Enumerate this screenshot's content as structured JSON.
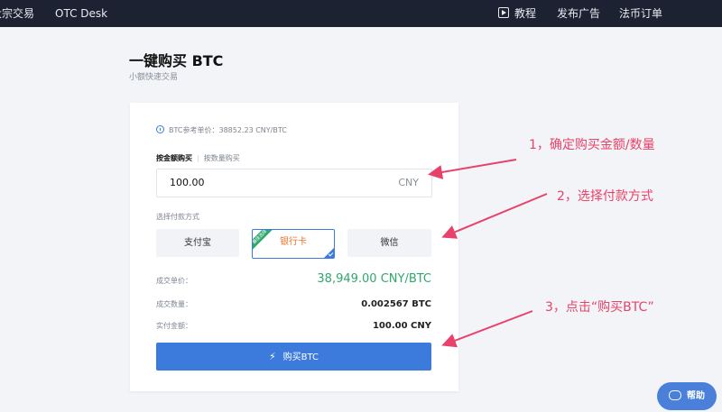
{
  "nav": {
    "left_items": [
      "大宗交易",
      "OTC Desk"
    ],
    "right_items": [
      "教程",
      "发布广告",
      "法币订单"
    ]
  },
  "header": {
    "title": "一键购买 BTC",
    "subtitle": "小额快速交易"
  },
  "form": {
    "reference_price": "BTC参考单价：38852.23 CNY/BTC",
    "mode_active": "按金额购买",
    "mode_other": "按数量购买",
    "amount_value": "100.00",
    "amount_unit": "CNY",
    "pay_method_label": "选择付款方式",
    "pay_methods": [
      "支付宝",
      "银行卡",
      "微信"
    ],
    "selected_ribbon": "最佳选择",
    "unit_price_label": "成交单价：",
    "unit_price_value": "38,949.00 CNY/BTC",
    "quantity_label": "成交数量：",
    "quantity_value": "0.002567 BTC",
    "total_label": "实付金额：",
    "total_value": "100.00 CNY",
    "buy_button": "购买BTC"
  },
  "annotations": [
    "1，确定购买金额/数量",
    "2，选择付款方式",
    "3，点击“购买BTC”"
  ],
  "help": "帮助",
  "colors": {
    "accent": "#3c7bdc",
    "price_green": "#2fa86c",
    "annotation_pink": "#e8426a",
    "topbar": "#1c2232"
  }
}
